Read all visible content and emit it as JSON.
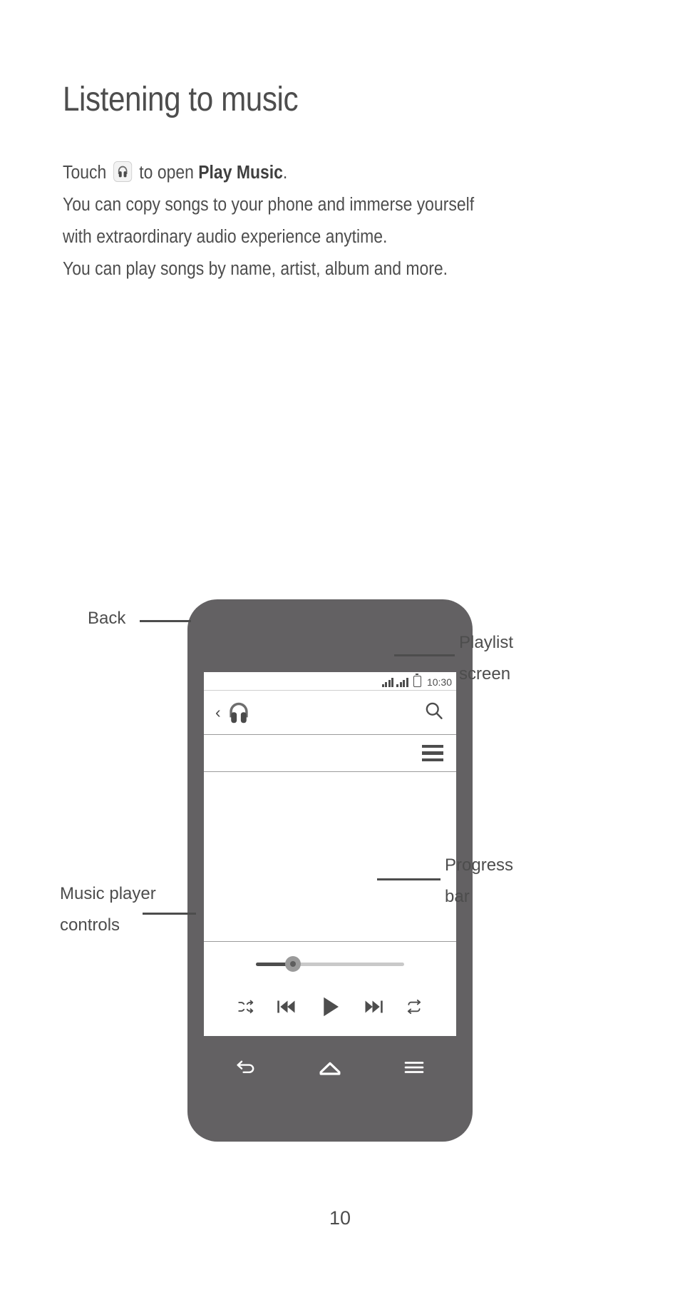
{
  "document": {
    "title": "Listening to music",
    "paragraph_lines": [
      {
        "pre": "Touch ",
        "icon": "headphones-icon",
        "mid": " to open ",
        "bold": "Play Music",
        "post": "."
      },
      {
        "text": "You can copy songs to your phone and immerse yourself"
      },
      {
        "text": "with extraordinary audio experience anytime."
      },
      {
        "text": "You can play songs by name, artist, album and more."
      }
    ],
    "page_number": "10"
  },
  "phone": {
    "status_bar": {
      "clock": "10:30",
      "signal_icon": "signal-bars-icon",
      "signal_icon_2": "signal-bars-icon-2",
      "battery_icon": "battery-icon"
    },
    "action_bar": {
      "back_icon": "back-chevron-icon",
      "app_icon": "headphones-app-icon",
      "search_icon": "search-icon"
    },
    "playlist_bar": {
      "playlist_icon": "playlist-hamburger-icon"
    },
    "progress": {
      "percent": 25,
      "label": "progress-bar"
    },
    "controls": [
      {
        "name": "shuffle-icon"
      },
      {
        "name": "previous-track-icon"
      },
      {
        "name": "play-icon"
      },
      {
        "name": "next-track-icon"
      },
      {
        "name": "repeat-icon"
      }
    ],
    "nav_bar": [
      {
        "name": "nav-back-icon"
      },
      {
        "name": "nav-home-icon"
      },
      {
        "name": "nav-menu-icon"
      }
    ]
  },
  "callouts": {
    "back": "Back",
    "playlist_line1": "Playlist",
    "playlist_line2": "screen",
    "progress_line1": "Progress",
    "progress_line2": "bar",
    "controls_line1": "Music player",
    "controls_line2": "controls"
  },
  "colors": {
    "ink": "#4d4d4d",
    "phone_body": "#636163",
    "track": "#c9c9c9",
    "thumb": "#9a9a9a"
  }
}
